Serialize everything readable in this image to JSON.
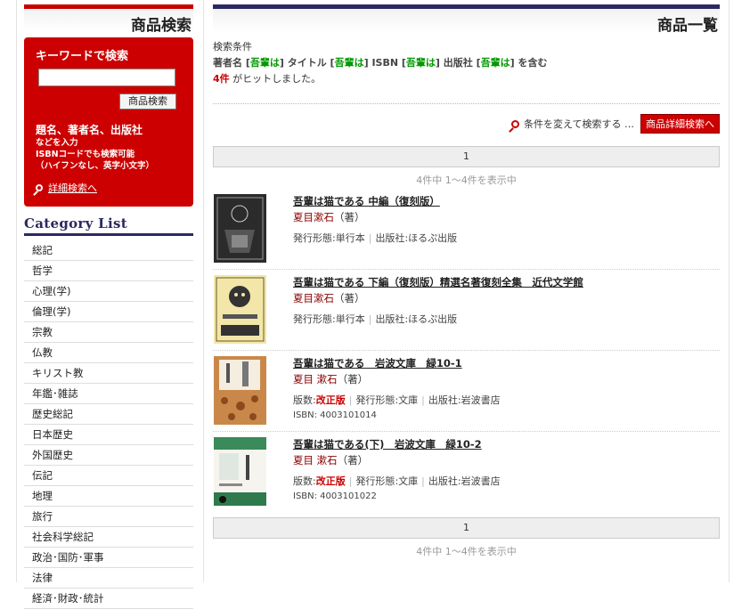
{
  "sidebar": {
    "title": "商品検索",
    "search": {
      "title": "キーワードで検索",
      "input_value": "",
      "button": "商品検索",
      "hint_main": "題名、著者名、出版社",
      "hint_lines": [
        "などを入力",
        "ISBNコードでも検索可能",
        "（ハイフンなし、英字小文字）"
      ],
      "advanced_link": "詳細検索へ"
    },
    "category_title": "Category List",
    "categories": [
      "総記",
      "哲学",
      "心理(学)",
      "倫理(学)",
      "宗教",
      "仏教",
      "キリスト教",
      "年鑑･雑誌",
      "歴史総記",
      "日本歴史",
      "外国歴史",
      "伝記",
      "地理",
      "旅行",
      "社会科学総記",
      "政治･国防･軍事",
      "法律",
      "経済･財政･統計"
    ]
  },
  "main": {
    "title": "商品一覧",
    "conditions_label": "検索条件",
    "conditions": [
      {
        "field": "著者名",
        "keyword": "吾輩は"
      },
      {
        "field": "タイトル",
        "keyword": "吾輩は"
      },
      {
        "field": "ISBN",
        "keyword": "吾輩は"
      },
      {
        "field": "出版社",
        "keyword": "吾輩は"
      }
    ],
    "conditions_suffix": "を含む",
    "hit_count": "4件",
    "hit_suffix": "がヒットしました。",
    "change_search": "条件を変えて検索する …",
    "detail_button": "商品詳細検索へ",
    "pager_page": "1",
    "showing": "4件中 1～4件を表示中"
  },
  "products": [
    {
      "title": "吾輩は猫である 中編（復刻版）",
      "author": "夏目漱石",
      "role": "（著）",
      "meta": [
        {
          "label": "発行形態",
          "value": "単行本"
        },
        {
          "label": "出版社",
          "value": "ほるぷ出版"
        }
      ],
      "isbn": ""
    },
    {
      "title": "吾輩は猫である 下編（復刻版）精選名著復刻全集　近代文学館",
      "author": "夏目漱石",
      "role": "（著）",
      "meta": [
        {
          "label": "発行形態",
          "value": "単行本"
        },
        {
          "label": "出版社",
          "value": "ほるぷ出版"
        }
      ],
      "isbn": ""
    },
    {
      "title": "吾輩は猫である　岩波文庫　緑10-1",
      "author": "夏目 漱石",
      "role": "（著）",
      "meta": [
        {
          "label": "版数",
          "value": "改正版",
          "red": true
        },
        {
          "label": "発行形態",
          "value": "文庫"
        },
        {
          "label": "出版社",
          "value": "岩波書店"
        }
      ],
      "isbn": "ISBN: 4003101014"
    },
    {
      "title": "吾輩は猫である(下)　岩波文庫　緑10-2",
      "author": "夏目 漱石",
      "role": "（著）",
      "meta": [
        {
          "label": "版数",
          "value": "改正版",
          "red": true
        },
        {
          "label": "発行形態",
          "value": "文庫"
        },
        {
          "label": "出版社",
          "value": "岩波書店"
        }
      ],
      "isbn": "ISBN: 4003101022"
    }
  ]
}
